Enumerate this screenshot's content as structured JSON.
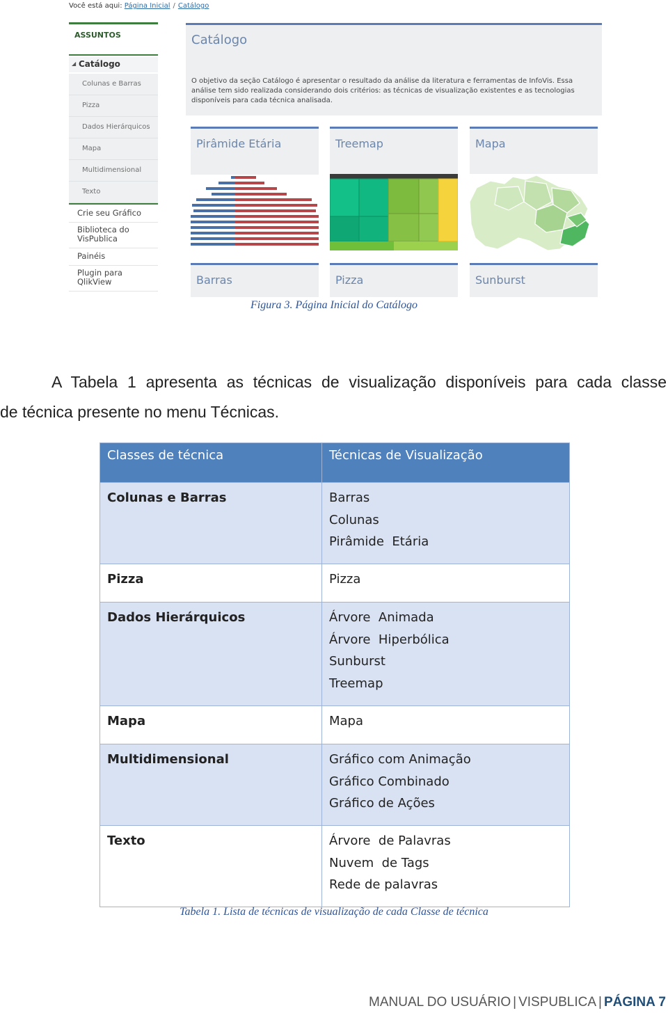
{
  "figure": {
    "breadcrumb": {
      "prefix": "Você está aqui:",
      "home": "Página Inicial",
      "separator": "/",
      "current": "Catálogo"
    },
    "sidebar": {
      "header": "ASSUNTOS",
      "catalog": "Catálogo",
      "sub_items": [
        "Colunas e Barras",
        "Pizza",
        "Dados Hierárquicos",
        "Mapa",
        "Multidimensional",
        "Texto"
      ],
      "items": [
        "Crie seu Gráfico",
        "Biblioteca do VisPublica",
        "Painéis",
        "Plugin para QlikView"
      ]
    },
    "catalog_panel": {
      "title": "Catálogo",
      "description": "O objetivo da seção Catálogo é apresentar o resultado da análise da literatura e ferramentas de InfoVis. Essa análise tem sido realizada considerando dois critérios: as técnicas de visualização existentes e as tecnologias disponíveis para cada técnica analisada."
    },
    "tiles": [
      "Pirâmide Etária",
      "Treemap",
      "Mapa",
      "Barras",
      "Pizza",
      "Sunburst"
    ],
    "colors": {
      "accent": "#5a7bb5",
      "sidebar_green": "#3d7d3d",
      "pyramid_blue": "#4a6fa5",
      "pyramid_red": "#b5474a"
    }
  },
  "figure_caption": "Figura 3. Página Inicial do Catálogo",
  "paragraph": {
    "line1": "A Tabela 1 apresenta as técnicas de visualização disponíveis para cada classe",
    "line2": "de técnica presente no menu Técnicas."
  },
  "table": {
    "headers": [
      "Classes de técnica",
      "Técnicas de Visualização"
    ],
    "rows": [
      {
        "class": "Colunas e Barras",
        "techniques": [
          "Barras",
          "Colunas",
          "Pirâmide  Etária"
        ]
      },
      {
        "class": "Pizza",
        "techniques": [
          "Pizza"
        ]
      },
      {
        "class": "Dados Hierárquicos",
        "techniques": [
          "Árvore  Animada",
          "Árvore  Hiperbólica",
          "Sunburst",
          "Treemap"
        ]
      },
      {
        "class": "Mapa",
        "techniques": [
          "Mapa"
        ]
      },
      {
        "class": "Multidimensional",
        "techniques": [
          "Gráfico com Animação",
          "Gráfico Combinado",
          "Gráfico de Ações"
        ]
      },
      {
        "class": "Texto",
        "techniques": [
          "Árvore  de Palavras",
          "Nuvem  de Tags",
          "Rede de palavras"
        ]
      }
    ],
    "header_color": "#4f81bd",
    "band_color": "#d9e2f2"
  },
  "table_caption": "Tabela 1. Lista de técnicas de visualização de cada Classe de técnica",
  "footer": {
    "manual": "MANUAL DO USUÁRIO",
    "product": "VISPUBLICA",
    "page": "PÁGINA 7",
    "separator": "|"
  }
}
